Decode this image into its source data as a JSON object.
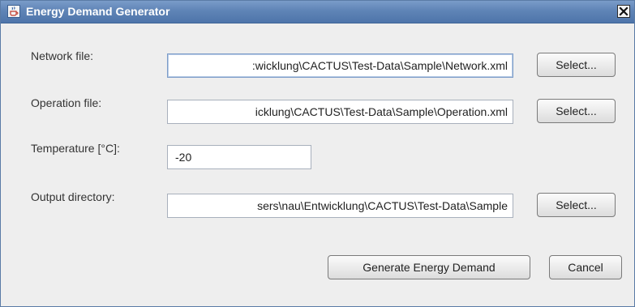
{
  "window": {
    "title": "Energy Demand Generator",
    "app_icon": "java-cup-icon",
    "close_icon": "close-x-icon"
  },
  "form": {
    "network": {
      "label": "Network file:",
      "value": ":wicklung\\CACTUS\\Test-Data\\Sample\\Network.xml",
      "button": "Select..."
    },
    "operation": {
      "label": "Operation file:",
      "value": "icklung\\CACTUS\\Test-Data\\Sample\\Operation.xml",
      "button": "Select..."
    },
    "temperature": {
      "label": "Temperature [°C]:",
      "value": "-20"
    },
    "output": {
      "label": "Output directory:",
      "value": "sers\\nau\\Entwicklung\\CACTUS\\Test-Data\\Sample",
      "button": "Select..."
    }
  },
  "actions": {
    "generate": "Generate Energy Demand",
    "cancel": "Cancel"
  },
  "colors": {
    "titlebar": "#5f84b6",
    "background": "#eeeeee"
  }
}
